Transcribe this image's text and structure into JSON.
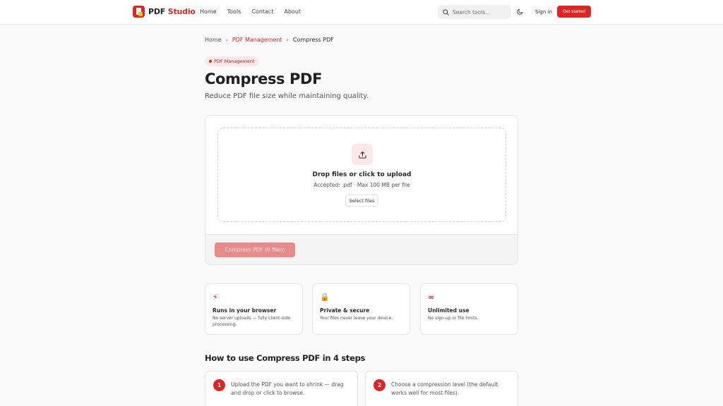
{
  "brand": {
    "name_part1": "PDF",
    "name_part2": "Studio",
    "accent": "#dc2626"
  },
  "nav": {
    "items": [
      "Home",
      "Tools",
      "Contact",
      "About"
    ]
  },
  "search": {
    "placeholder": "Search tools..."
  },
  "header": {
    "signin_label": "Sign in",
    "cta_label": "Get started"
  },
  "breadcrumb": {
    "home": "Home",
    "category": "PDF Management",
    "current": "Compress PDF"
  },
  "badge": {
    "label": "PDF Management"
  },
  "page": {
    "title": "Compress PDF",
    "subtitle": "Reduce PDF file size while maintaining quality."
  },
  "upload": {
    "title": "Drop files or click to upload",
    "hint": "Accepted: .pdf · Max 100 MB per file",
    "select_label": "Select files",
    "action_label": "Compress PDF (0 files)"
  },
  "features": [
    {
      "icon": "lightning-icon",
      "glyph": "⚡",
      "title": "Runs in your browser",
      "desc": "No server uploads — fully client-side processing."
    },
    {
      "icon": "lock-icon",
      "glyph": "🔒",
      "title": "Private & secure",
      "desc": "Your files never leave your device."
    },
    {
      "icon": "infinity-icon",
      "glyph": "∞",
      "title": "Unlimited use",
      "desc": "No sign-up or file limits."
    }
  ],
  "howto": {
    "title": "How to use Compress PDF in 4 steps",
    "steps": [
      {
        "num": "1",
        "text": "Upload the PDF you want to shrink — drag and drop or click to browse."
      },
      {
        "num": "2",
        "text": "Choose a compression level (the default works well for most files)."
      }
    ]
  }
}
